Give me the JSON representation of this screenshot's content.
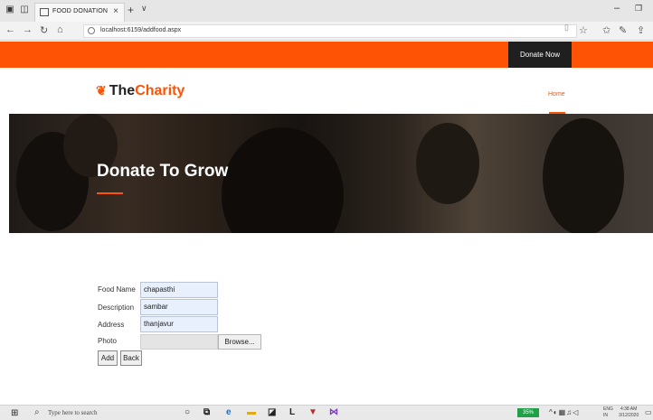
{
  "browser": {
    "tab_title": "FOOD DONATION",
    "tab_close": "×",
    "new_tab": "+",
    "tab_list": "∨",
    "url": "localhost:6159/addfood.aspx",
    "nav_back": "←",
    "nav_forward": "→",
    "nav_refresh": "↻",
    "nav_home": "⌂",
    "win_minimize": "–",
    "win_maximize": "❐"
  },
  "site": {
    "donate_now": "Donate Now",
    "logo_part1": "The",
    "logo_part2": "Charity",
    "nav_home": "Home",
    "hero_title": "Donate To Grow"
  },
  "form": {
    "food_name_label": "Food Name",
    "food_name_value": "chapasthi",
    "description_label": "Description",
    "description_value": "sambar",
    "address_label": "Address",
    "address_value": "thanjavur",
    "photo_label": "Photo",
    "browse_label": "Browse...",
    "add_label": "Add",
    "back_label": "Back"
  },
  "taskbar": {
    "search_placeholder": "Type here to search",
    "battery": "35%",
    "lang_line1": "ENG",
    "lang_line2": "IN",
    "time": "4:38 AM",
    "date": "3/12/2020"
  },
  "colors": {
    "accent": "#fe5205",
    "dark": "#1f1f1f"
  }
}
